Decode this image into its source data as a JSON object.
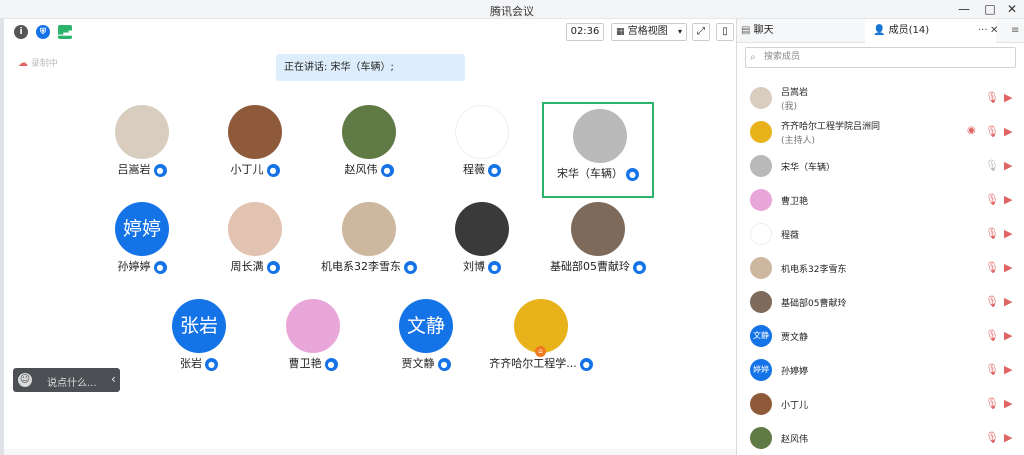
{
  "window": {
    "title": "腾讯会议",
    "controls": {
      "minimize": "—",
      "maximize": "□",
      "close": "✕"
    }
  },
  "toolbar": {
    "timer": "02:36",
    "view_label": "宫格视图",
    "view_caret": "▾",
    "fullscreen_icon": "⤢",
    "sidebar_icon": "▯",
    "info_icon": "i",
    "shield_icon": "⛨",
    "signal_icon": "▁▃▅"
  },
  "recording_label": "录制中",
  "speaking_banner": "正在讲话: 宋华（车辆）;",
  "grid": {
    "participants": [
      {
        "name": "吕嵩岩",
        "avatar_type": "photo",
        "avatar_text": "",
        "color": "#d9cdbf"
      },
      {
        "name": "小丁儿",
        "avatar_type": "photo",
        "avatar_text": "",
        "color": "#8e5a3a"
      },
      {
        "name": "赵风伟",
        "avatar_type": "photo",
        "avatar_text": "",
        "color": "#5f7a45"
      },
      {
        "name": "程薇",
        "avatar_type": "photo",
        "avatar_text": "",
        "color": "#ffffff"
      },
      {
        "name": "宋华（车辆）",
        "avatar_type": "photo",
        "avatar_text": "",
        "color": "#b9b9b9"
      },
      {
        "name": "孙婷婷",
        "avatar_type": "text",
        "avatar_text": "婷婷",
        "color": "#1473e6"
      },
      {
        "name": "周长满",
        "avatar_type": "photo",
        "avatar_text": "",
        "color": "#e2c2b0"
      },
      {
        "name": "机电系32李雪东",
        "avatar_type": "photo",
        "avatar_text": "",
        "color": "#cdb79e"
      },
      {
        "name": "刘博",
        "avatar_type": "photo",
        "avatar_text": "",
        "color": "#3a3a3a"
      },
      {
        "name": "基础部05曹献玲",
        "avatar_type": "photo",
        "avatar_text": "",
        "color": "#7d6a5a"
      },
      {
        "name": "张岩",
        "avatar_type": "text",
        "avatar_text": "张岩",
        "color": "#1473e6"
      },
      {
        "name": "曹卫艳",
        "avatar_type": "photo",
        "avatar_text": "",
        "color": "#e9a6d8"
      },
      {
        "name": "贾文静",
        "avatar_type": "text",
        "avatar_text": "文静",
        "color": "#1473e6"
      },
      {
        "name": "齐齐哈尔工程学...",
        "avatar_type": "photo",
        "avatar_text": "",
        "color": "#e8b21a"
      }
    ],
    "mic_icon": "🎤",
    "host_icon": "⌂"
  },
  "chat_bubble": {
    "placeholder": "说点什么...",
    "collapse_icon": "‹",
    "emoji_icon": "☺"
  },
  "panel": {
    "tab_chat": "聊天",
    "tab_members": "成员(14)",
    "more_icon": "···",
    "close_icon": "✕",
    "menu_icon": "≡",
    "search_placeholder": "搜索成员",
    "muted_mic_icon": "🎙",
    "cam_off_icon": "▶",
    "eye_icon": "◉",
    "members": [
      {
        "name": "吕嵩岩",
        "role": "(我)",
        "avatar_text": "",
        "color": "#d9cdbf",
        "eye": false
      },
      {
        "name": "齐齐哈尔工程学院吕洲同",
        "role": "(主持人)",
        "avatar_text": "",
        "color": "#e8b21a",
        "eye": true
      },
      {
        "name": "宋华（车辆）",
        "role": "",
        "avatar_text": "",
        "color": "#b9b9b9",
        "eye": false
      },
      {
        "name": "曹卫艳",
        "role": "",
        "avatar_text": "",
        "color": "#e9a6d8",
        "eye": false
      },
      {
        "name": "程薇",
        "role": "",
        "avatar_text": "",
        "color": "#ffffff",
        "eye": false
      },
      {
        "name": "机电系32李雪东",
        "role": "",
        "avatar_text": "",
        "color": "#cdb79e",
        "eye": false
      },
      {
        "name": "基础部05曹献玲",
        "role": "",
        "avatar_text": "",
        "color": "#7d6a5a",
        "eye": false
      },
      {
        "name": "贾文静",
        "role": "",
        "avatar_text": "文静",
        "color": "#1473e6",
        "eye": false
      },
      {
        "name": "孙婷婷",
        "role": "",
        "avatar_text": "婷婷",
        "color": "#1473e6",
        "eye": false
      },
      {
        "name": "小丁儿",
        "role": "",
        "avatar_text": "",
        "color": "#8e5a3a",
        "eye": false
      },
      {
        "name": "赵风伟",
        "role": "",
        "avatar_text": "",
        "color": "#5f7a45",
        "eye": false
      }
    ]
  }
}
